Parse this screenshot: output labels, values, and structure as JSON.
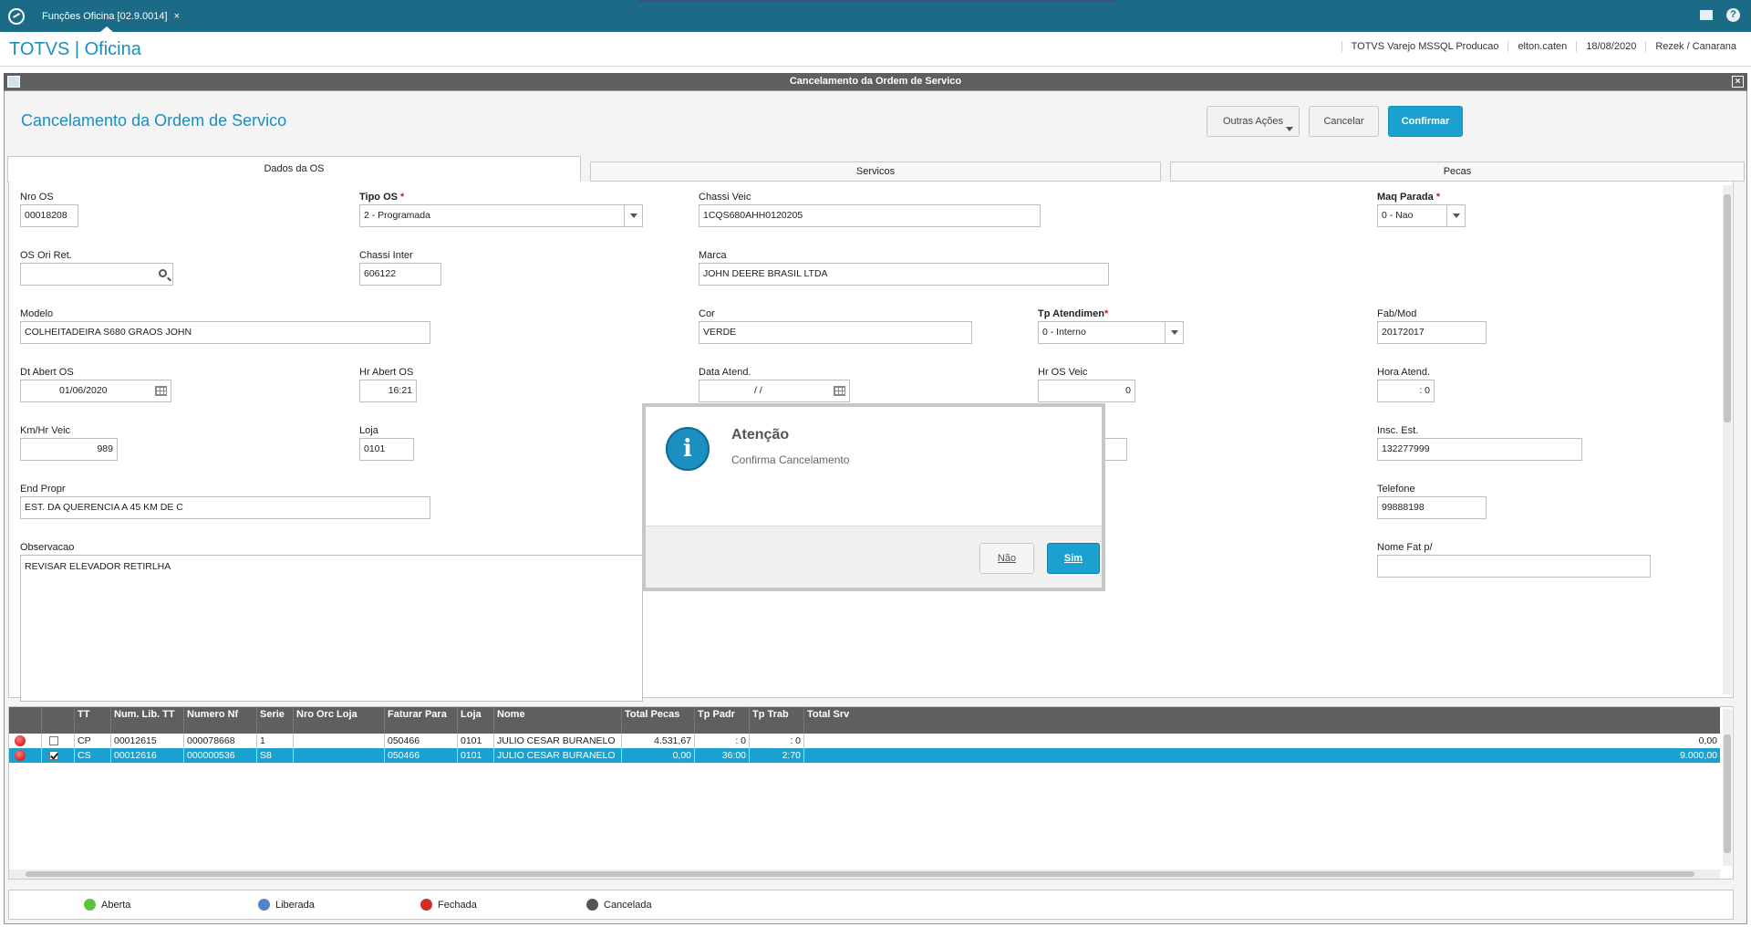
{
  "topbar": {
    "tab_title": "Funções Oficina [02.9.0014]",
    "tab_close": "×",
    "help": "?"
  },
  "header": {
    "brand": "TOTVS | Oficina",
    "environment": "TOTVS Varejo MSSQL Producao",
    "user": "elton.caten",
    "date": "18/08/2020",
    "branch": "Rezek / Canarana"
  },
  "window": {
    "title": "Cancelamento da Ordem de Servico",
    "close": "×"
  },
  "page": {
    "title": "Cancelamento da Ordem de Servico",
    "actions": {
      "more": "Outras Ações",
      "cancel": "Cancelar",
      "confirm": "Confirmar"
    }
  },
  "tabs": [
    "Dados da OS",
    "Servicos",
    "Pecas"
  ],
  "form": {
    "nro_os": {
      "label": "Nro OS",
      "value": "00018208"
    },
    "tipo_os": {
      "label": "Tipo OS",
      "value": "2 - Programada"
    },
    "chassi_veic": {
      "label": "Chassi Veic",
      "value": "1CQS680AHH0120205"
    },
    "maq_parada": {
      "label": "Maq Parada",
      "value": "0 - Nao"
    },
    "os_ori_ret": {
      "label": "OS Ori Ret.",
      "value": ""
    },
    "chassi_inter": {
      "label": "Chassi Inter",
      "value": "606122"
    },
    "marca": {
      "label": "Marca",
      "value": "JOHN DEERE BRASIL LTDA"
    },
    "modelo": {
      "label": "Modelo",
      "value": "COLHEITADEIRA S680 GRAOS  JOHN"
    },
    "cor": {
      "label": "Cor",
      "value": "VERDE"
    },
    "tp_atendimen": {
      "label": "Tp Atendimen",
      "value": "0 - Interno"
    },
    "fab_mod": {
      "label": "Fab/Mod",
      "value": "20172017"
    },
    "dt_abert_os": {
      "label": "Dt Abert OS",
      "value": "01/06/2020"
    },
    "hr_abert_os": {
      "label": "Hr Abert OS",
      "value": "16:21"
    },
    "data_atend": {
      "label": "Data Atend.",
      "value": "/  /"
    },
    "hr_os_veic": {
      "label": "Hr OS Veic",
      "value": "0"
    },
    "hora_atend": {
      "label": "Hora Atend.",
      "value": ": 0"
    },
    "km_hr_veic": {
      "label": "Km/Hr Veic",
      "value": "989"
    },
    "loja": {
      "label": "Loja",
      "value": "0101"
    },
    "insc_est": {
      "label": "Insc. Est.",
      "value": "132277999"
    },
    "end_propr": {
      "label": "End Propr",
      "value": "EST. DA QUERENCIA A 45 KM DE C"
    },
    "telefone": {
      "label": "Telefone",
      "value": "99888198"
    },
    "observacao": {
      "label": "Observacao",
      "value": "REVISAR ELEVADOR RETIRLHA"
    },
    "nome_fat": {
      "label": "Nome Fat p/",
      "value": ""
    },
    "required_mark": "*"
  },
  "grid": {
    "columns": [
      "TT",
      "Num. Lib. TT",
      "Numero Nf",
      "Serie",
      "Nro Orc Loja",
      "Faturar Para",
      "Loja",
      "Nome",
      "Total Pecas",
      "Tp Padr",
      "Tp Trab",
      "Total Srv"
    ],
    "rows": [
      {
        "status": "red",
        "checked": false,
        "tt": "CP",
        "num_lib": "00012615",
        "numero_nf": "000078668",
        "serie": "1",
        "nro_orc": "",
        "faturar_para": "050466",
        "loja": "0101",
        "nome": "JULIO CESAR BURANELO",
        "total_pecas": "4.531,67",
        "tp_padr": ": 0",
        "tp_trab": ": 0",
        "total_srv": "0,00"
      },
      {
        "status": "red",
        "checked": true,
        "tt": "CS",
        "num_lib": "00012616",
        "numero_nf": "000000536",
        "serie": "S8",
        "nro_orc": "",
        "faturar_para": "050466",
        "loja": "0101",
        "nome": "JULIO CESAR BURANELO",
        "total_pecas": "0,00",
        "tp_padr": "36:00",
        "tp_trab": "2:70",
        "total_srv": "9.000,00"
      }
    ]
  },
  "legend": [
    {
      "label": "Aberta",
      "color": "#5cc43a"
    },
    {
      "label": "Liberada",
      "color": "#4f86c6"
    },
    {
      "label": "Fechada",
      "color": "#d42a2a"
    },
    {
      "label": "Cancelada",
      "color": "#555555"
    }
  ],
  "dialog": {
    "icon": "i",
    "title": "Atenção",
    "message": "Confirma Cancelamento",
    "no": "Não",
    "yes": "Sim"
  }
}
